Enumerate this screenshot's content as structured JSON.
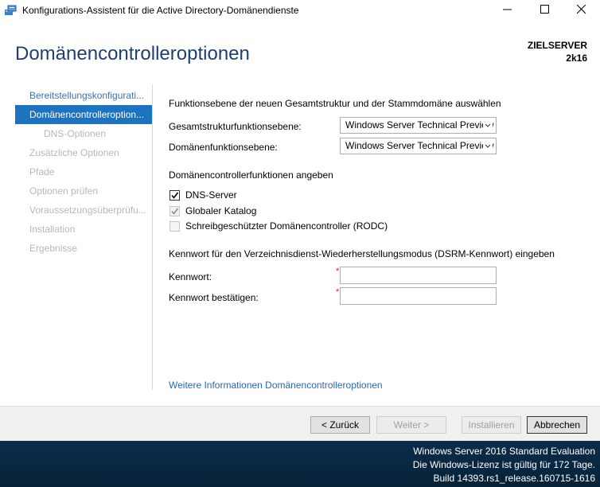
{
  "window": {
    "title": "Konfigurations-Assistent für die Active Directory-Domänendienste",
    "app_icon": "server-manager-icon",
    "controls": [
      "minimize-icon",
      "maximize-icon",
      "close-icon"
    ]
  },
  "header": {
    "page_title": "Domänencontrolleroptionen",
    "target_label": "ZIELSERVER",
    "target_name": "2k16"
  },
  "nav": {
    "items": [
      {
        "label": "Bereitstellungskonfigurati...",
        "state": "visited"
      },
      {
        "label": "Domänencontrolleroption...",
        "state": "active"
      },
      {
        "label": "DNS-Optionen",
        "state": "disabled"
      },
      {
        "label": "Zusätzliche Optionen",
        "state": "disabled"
      },
      {
        "label": "Pfade",
        "state": "disabled"
      },
      {
        "label": "Optionen prüfen",
        "state": "disabled"
      },
      {
        "label": "Voraussetzungsüberprüfu...",
        "state": "disabled"
      },
      {
        "label": "Installation",
        "state": "disabled"
      },
      {
        "label": "Ergebnisse",
        "state": "disabled"
      }
    ]
  },
  "main": {
    "functional_level_heading": "Funktionsebene der neuen Gesamtstruktur und der Stammdomäne auswählen",
    "forest_level_label": "Gesamtstrukturfunktionsebene:",
    "forest_level_value": "Windows Server Technical Preview",
    "domain_level_label": "Domänenfunktionsebene:",
    "domain_level_value": "Windows Server Technical Preview",
    "dc_capabilities_heading": "Domänencontrollerfunktionen angeben",
    "checkboxes": [
      {
        "label": "DNS-Server",
        "checked": true,
        "enabled": true
      },
      {
        "label": "Globaler Katalog",
        "checked": true,
        "enabled": false
      },
      {
        "label": "Schreibgeschützter Domänencontroller (RODC)",
        "checked": false,
        "enabled": false
      }
    ],
    "dsrm_heading": "Kennwort für den Verzeichnisdienst-Wiederherstellungsmodus (DSRM-Kennwort) eingeben",
    "password_label": "Kennwort:",
    "password_value": "",
    "confirm_label": "Kennwort bestätigen:",
    "confirm_value": "",
    "required_marker": "*",
    "more_info_link": "Weitere Informationen Domänencontrolleroptionen"
  },
  "footer": {
    "back_label": "< Zurück",
    "next_label": "Weiter >",
    "install_label": "Installieren",
    "cancel_label": "Abbrechen"
  },
  "desktop": {
    "watermark_line1": "Windows Server 2016 Standard Evaluation",
    "watermark_line2": "Die Windows-Lizenz ist gültig für 172 Tage.",
    "watermark_line3": "Build 14393.rs1_release.160715-1616"
  },
  "colors": {
    "accent": "#1e73be",
    "title_blue": "#1e3f73",
    "link": "#2b66b8",
    "required": "#e81123"
  }
}
